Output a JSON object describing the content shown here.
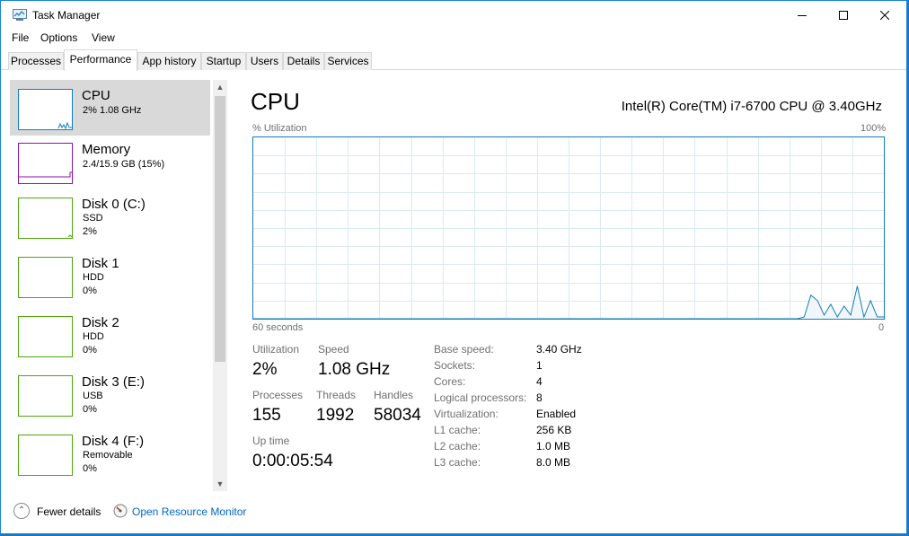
{
  "window": {
    "title": "Task Manager"
  },
  "menu": [
    "File",
    "Options",
    "View"
  ],
  "tabs": [
    "Processes",
    "Performance",
    "App history",
    "Startup",
    "Users",
    "Details",
    "Services"
  ],
  "active_tab": "Performance",
  "sidebar": [
    {
      "title": "CPU",
      "line1": "2%  1.08 GHz",
      "line2": "",
      "color": "#117dbb",
      "selected": true
    },
    {
      "title": "Memory",
      "line1": "2.4/15.9 GB (15%)",
      "line2": "",
      "color": "#8b12ae",
      "selected": false
    },
    {
      "title": "Disk 0 (C:)",
      "line1": "SSD",
      "line2": "2%",
      "color": "#4da60c",
      "selected": false
    },
    {
      "title": "Disk 1",
      "line1": "HDD",
      "line2": "0%",
      "color": "#4da60c",
      "selected": false
    },
    {
      "title": "Disk 2",
      "line1": "HDD",
      "line2": "0%",
      "color": "#4da60c",
      "selected": false
    },
    {
      "title": "Disk 3 (E:)",
      "line1": "USB",
      "line2": "0%",
      "color": "#4da60c",
      "selected": false
    },
    {
      "title": "Disk 4 (F:)",
      "line1": "Removable",
      "line2": "0%",
      "color": "#4da60c",
      "selected": false
    }
  ],
  "main": {
    "title": "CPU",
    "cpu_model": "Intel(R) Core(TM) i7-6700 CPU @ 3.40GHz",
    "graph": {
      "y_label": "% Utilization",
      "y_max_label": "100%",
      "x_label": "60 seconds",
      "x_min_label": "0",
      "color": "#117dbb",
      "utilization_history": [
        0,
        0,
        0,
        0,
        0,
        0,
        0,
        0,
        0,
        0,
        0,
        0,
        0,
        0,
        0,
        0,
        0,
        0,
        0,
        0,
        0,
        0,
        0,
        0,
        0,
        0,
        0,
        0,
        0,
        0,
        0,
        0,
        0,
        0,
        0,
        0,
        0,
        0,
        0,
        0,
        0,
        0,
        0,
        0,
        0,
        0,
        0,
        0,
        0,
        0,
        0,
        0,
        0,
        0,
        0,
        0,
        0,
        0,
        0,
        0,
        0,
        0,
        0,
        0,
        0,
        0,
        0,
        0,
        0,
        0,
        0,
        0,
        0,
        0,
        0,
        0,
        0,
        0,
        0,
        0,
        0,
        0,
        0,
        1,
        13,
        10,
        2,
        8,
        1,
        7,
        2,
        18,
        1,
        10,
        1,
        1
      ]
    },
    "stats": {
      "utilization_label": "Utilization",
      "utilization": "2%",
      "speed_label": "Speed",
      "speed": "1.08 GHz",
      "processes_label": "Processes",
      "processes": "155",
      "threads_label": "Threads",
      "threads": "1992",
      "handles_label": "Handles",
      "handles": "58034",
      "uptime_label": "Up time",
      "uptime": "0:00:05:54"
    },
    "specs": [
      {
        "key": "Base speed:",
        "value": "3.40 GHz"
      },
      {
        "key": "Sockets:",
        "value": "1"
      },
      {
        "key": "Cores:",
        "value": "4"
      },
      {
        "key": "Logical processors:",
        "value": "8"
      },
      {
        "key": "Virtualization:",
        "value": "Enabled"
      },
      {
        "key": "L1 cache:",
        "value": "256 KB"
      },
      {
        "key": "L2 cache:",
        "value": "1.0 MB"
      },
      {
        "key": "L3 cache:",
        "value": "8.0 MB"
      }
    ]
  },
  "footer": {
    "fewer_details": "Fewer details",
    "resource_monitor": "Open Resource Monitor"
  }
}
